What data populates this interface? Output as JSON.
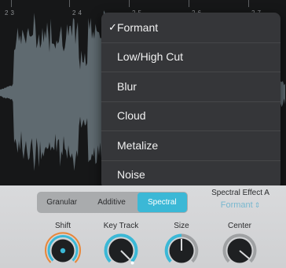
{
  "ruler": {
    "labels": [
      "23",
      "24",
      "25",
      "26",
      "27"
    ]
  },
  "menu": {
    "items": [
      {
        "label": "Formant",
        "checked": true
      },
      {
        "label": "Low/High Cut",
        "checked": false
      },
      {
        "label": "Blur",
        "checked": false
      },
      {
        "label": "Cloud",
        "checked": false
      },
      {
        "label": "Metalize",
        "checked": false
      },
      {
        "label": "Noise",
        "checked": false
      }
    ],
    "check_glyph": "✓"
  },
  "synth_mode": {
    "tabs": [
      "Granular",
      "Additive",
      "Spectral"
    ],
    "selected": "Spectral"
  },
  "spectral_effect": {
    "title": "Spectral Effect A",
    "value": "Formant",
    "chevron_icon": "up-down-chevron-icon"
  },
  "knobs": {
    "shift": {
      "label": "Shift"
    },
    "key_track": {
      "label": "Key Track"
    },
    "size": {
      "label": "Size"
    },
    "center": {
      "label": "Center"
    }
  },
  "colors": {
    "accent": "#3bb8d6",
    "orange_ring": "#e8873a",
    "menu_bg": "#353639",
    "panel_bg": "#d4d5d7",
    "waveform": "#5f6a70"
  }
}
